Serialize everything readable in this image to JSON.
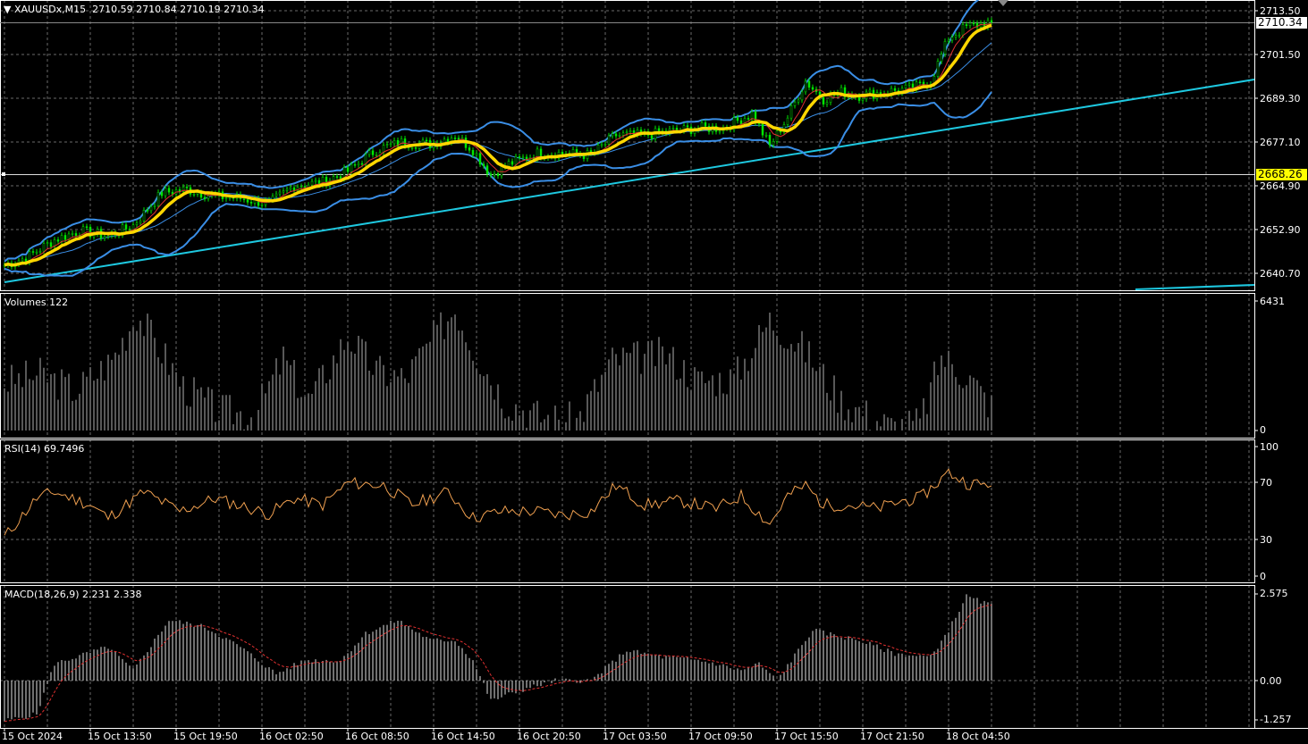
{
  "header": {
    "symbol": "XAUUSDx,M15",
    "open": "2710.59",
    "high": "2710.84",
    "low": "2710.19",
    "close": "2710.34"
  },
  "price_axis": [
    "2713.50",
    "2701.50",
    "2689.30",
    "2677.10",
    "2664.90",
    "2652.90",
    "2640.70"
  ],
  "current_price_tag": "2710.34",
  "hline_tag": "2668.26",
  "volumes": {
    "label": "Volumes 122",
    "max": "6431",
    "min": "0"
  },
  "rsi": {
    "label": "RSI(14) 69.7496",
    "levels": [
      "100",
      "70",
      "30",
      "0"
    ]
  },
  "macd": {
    "label": "MACD(18,26,9) 2.231 2.338",
    "levels": [
      "2.575",
      "0.00",
      "-1.257"
    ]
  },
  "time_axis": [
    "15 Oct 2024",
    "15 Oct 13:50",
    "15 Oct 19:50",
    "16 Oct 02:50",
    "16 Oct 08:50",
    "16 Oct 14:50",
    "16 Oct 20:50",
    "17 Oct 03:50",
    "17 Oct 09:50",
    "17 Oct 15:50",
    "17 Oct 21:50",
    "18 Oct 04:50"
  ],
  "colors": {
    "bull": "#00e600",
    "band": "#3a8ee6",
    "ma": "#ffd700",
    "ma2": "#e03030",
    "trend": "#1ec8e0",
    "rsi": "#f0a050",
    "macd_signal": "#e03030",
    "grid": "#6a6a6a"
  },
  "chart_data": {
    "type": "candlestick",
    "bars": 277,
    "price_keypoints": [
      [
        0,
        2643
      ],
      [
        6,
        2645
      ],
      [
        14,
        2650
      ],
      [
        21,
        2652.5
      ],
      [
        29,
        2651
      ],
      [
        36,
        2654
      ],
      [
        44,
        2663
      ],
      [
        51,
        2664
      ],
      [
        59,
        2662
      ],
      [
        66,
        2661.5
      ],
      [
        74,
        2660
      ],
      [
        81,
        2665
      ],
      [
        89,
        2666
      ],
      [
        96,
        2669
      ],
      [
        104,
        2675
      ],
      [
        111,
        2677
      ],
      [
        119,
        2676.5
      ],
      [
        126,
        2679
      ],
      [
        131,
        2675
      ],
      [
        136,
        2668
      ],
      [
        141,
        2671
      ],
      [
        149,
        2674
      ],
      [
        156,
        2674
      ],
      [
        164,
        2673.5
      ],
      [
        171,
        2679
      ],
      [
        179,
        2679
      ],
      [
        186,
        2680
      ],
      [
        194,
        2681
      ],
      [
        201,
        2681
      ],
      [
        209,
        2685
      ],
      [
        214,
        2676
      ],
      [
        219,
        2684
      ],
      [
        224,
        2694
      ],
      [
        229,
        2689
      ],
      [
        234,
        2691
      ],
      [
        239,
        2690
      ],
      [
        246,
        2691
      ],
      [
        254,
        2692
      ],
      [
        259,
        2694
      ],
      [
        264,
        2706
      ],
      [
        269,
        2709
      ],
      [
        274,
        2710
      ],
      [
        276,
        2710.34
      ]
    ],
    "volume_keypoints": [
      [
        0,
        2400
      ],
      [
        10,
        2800
      ],
      [
        20,
        2000
      ],
      [
        30,
        3500
      ],
      [
        37,
        5800
      ],
      [
        42,
        4500
      ],
      [
        50,
        2200
      ],
      [
        60,
        1000
      ],
      [
        70,
        800
      ],
      [
        78,
        3600
      ],
      [
        85,
        1500
      ],
      [
        96,
        4700
      ],
      [
        104,
        3000
      ],
      [
        112,
        2600
      ],
      [
        126,
        6100
      ],
      [
        132,
        3800
      ],
      [
        140,
        1500
      ],
      [
        150,
        700
      ],
      [
        160,
        500
      ],
      [
        170,
        3500
      ],
      [
        185,
        3800
      ],
      [
        194,
        2500
      ],
      [
        204,
        2600
      ],
      [
        214,
        5500
      ],
      [
        224,
        4000
      ],
      [
        234,
        1500
      ],
      [
        248,
        200
      ],
      [
        256,
        400
      ],
      [
        262,
        3700
      ],
      [
        270,
        2600
      ],
      [
        276,
        1200
      ]
    ],
    "rsi_keypoints": [
      [
        0,
        30
      ],
      [
        9,
        60
      ],
      [
        14,
        65
      ],
      [
        24,
        55
      ],
      [
        29,
        45
      ],
      [
        39,
        65
      ],
      [
        49,
        50
      ],
      [
        59,
        60
      ],
      [
        74,
        48
      ],
      [
        81,
        60
      ],
      [
        89,
        55
      ],
      [
        96,
        72
      ],
      [
        106,
        70
      ],
      [
        114,
        55
      ],
      [
        124,
        65
      ],
      [
        131,
        45
      ],
      [
        139,
        50
      ],
      [
        149,
        50
      ],
      [
        156,
        47
      ],
      [
        164,
        50
      ],
      [
        171,
        70
      ],
      [
        179,
        55
      ],
      [
        189,
        58
      ],
      [
        199,
        52
      ],
      [
        206,
        62
      ],
      [
        214,
        40
      ],
      [
        219,
        62
      ],
      [
        224,
        70
      ],
      [
        229,
        55
      ],
      [
        236,
        55
      ],
      [
        244,
        52
      ],
      [
        251,
        58
      ],
      [
        256,
        60
      ],
      [
        264,
        80
      ],
      [
        269,
        72
      ],
      [
        276,
        69.75
      ]
    ],
    "macd_keypoints": [
      [
        0,
        -1.2
      ],
      [
        9,
        -1
      ],
      [
        14,
        0.5
      ],
      [
        29,
        1
      ],
      [
        36,
        0.3
      ],
      [
        46,
        1.8
      ],
      [
        56,
        1.6
      ],
      [
        66,
        1
      ],
      [
        76,
        0.2
      ],
      [
        84,
        0.6
      ],
      [
        94,
        0.6
      ],
      [
        101,
        1.4
      ],
      [
        110,
        1.8
      ],
      [
        119,
        1.2
      ],
      [
        126,
        1.2
      ],
      [
        131,
        0.6
      ],
      [
        136,
        -0.6
      ],
      [
        144,
        -0.3
      ],
      [
        154,
        0
      ],
      [
        164,
        0
      ],
      [
        174,
        0.9
      ],
      [
        184,
        0.7
      ],
      [
        194,
        0.6
      ],
      [
        199,
        0.5
      ],
      [
        206,
        0.3
      ],
      [
        211,
        0.5
      ],
      [
        216,
        0
      ],
      [
        226,
        1.5
      ],
      [
        234,
        1.3
      ],
      [
        239,
        1.2
      ],
      [
        249,
        0.8
      ],
      [
        259,
        0.7
      ],
      [
        264,
        1.5
      ],
      [
        269,
        2.5
      ],
      [
        276,
        2.231
      ]
    ],
    "price_range": [
      2636,
      2716
    ],
    "volume_range": [
      0,
      6431
    ],
    "rsi_range": [
      0,
      100
    ],
    "macd_range": [
      -1.257,
      2.575
    ]
  }
}
